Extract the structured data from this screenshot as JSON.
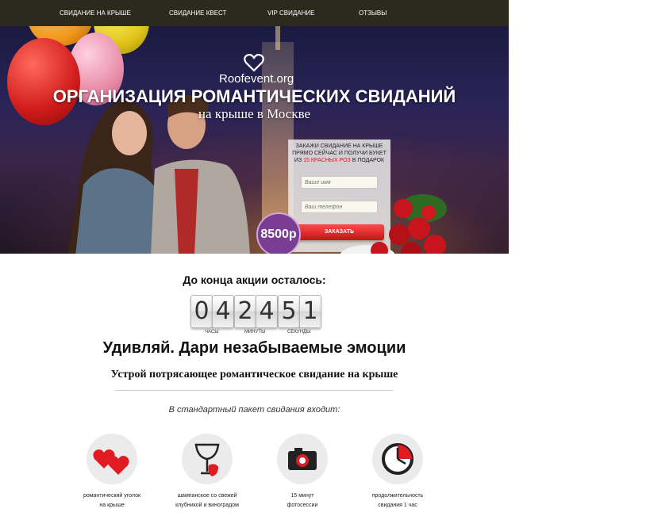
{
  "nav": {
    "items": [
      {
        "label": "СВИДАНИЕ НА КРЫШЕ"
      },
      {
        "label": "СВИДАНИЕ КВЕСТ"
      },
      {
        "label": "VIP СВИДАНИЕ"
      },
      {
        "label": "ОТЗЫВЫ"
      }
    ]
  },
  "hero": {
    "logo_text": "Roofevent.org",
    "title": "ОРГАНИЗАЦИЯ РОМАНТИЧЕСКИХ СВИДАНИЙ",
    "subtitle": "на крыше в Москве",
    "price": "8500р"
  },
  "form": {
    "line1": "ЗАКАЖИ СВИДАНИЕ НА КРЫШЕ",
    "line2": "ПРЯМО СЕЙЧАС И ПОЛУЧИ БУКЕТ",
    "line3_prefix": "ИЗ ",
    "line3_highlight": "15 КРАСНЫХ РОЗ",
    "line3_suffix": " В ПОДАРОК",
    "name_placeholder": "Ваше имя",
    "phone_placeholder": "Ваш телефон",
    "submit_label": "ЗАКАЗАТЬ"
  },
  "countdown": {
    "title": "До конца акции осталось:",
    "digits": [
      "0",
      "4",
      "2",
      "4",
      "5",
      "1"
    ],
    "labels": {
      "hours": "ЧАСЫ",
      "minutes": "МИНУТЫ",
      "seconds": "СЕКУНДЫ"
    }
  },
  "content": {
    "headline": "Удивляй. Дари незабываемые эмоции",
    "subheadline": "Устрой потрясающее романтическое свидание на крыше",
    "package_intro": "В стандартный пакет свидания входит:"
  },
  "features": [
    {
      "icon": "hearts-icon",
      "line1": "романтический уголок",
      "line2": "на крыше"
    },
    {
      "icon": "champagne-strawberry-icon",
      "line1": "шампанское со свежей",
      "line2": "клубникой и виноградом"
    },
    {
      "icon": "camera-icon",
      "line1": "15 минут",
      "line2": "фотосессии"
    },
    {
      "icon": "timer-icon",
      "line1": "продолжительность",
      "line2": "свидания 1 час"
    }
  ],
  "colors": {
    "nav_bg": "#2c2a1d",
    "accent_red": "#d21c1c",
    "price_badge": "#7b3c93",
    "icon_red": "#e01b22"
  }
}
